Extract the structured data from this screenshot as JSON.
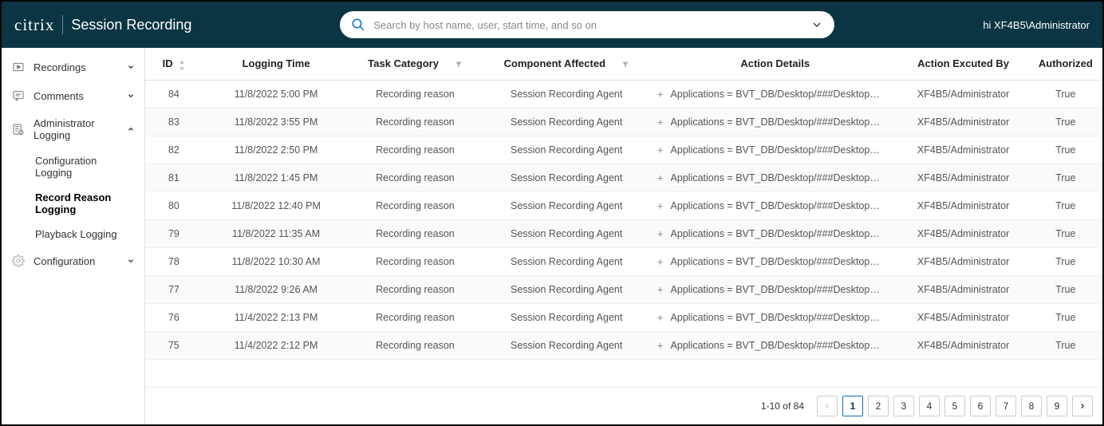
{
  "header": {
    "brand": "citrix",
    "subtitle": "Session Recording",
    "search_placeholder": "Search by host name, user, start time, and so on",
    "user_text": "hi XF4B5\\Administrator"
  },
  "sidebar": {
    "items": [
      {
        "label": "Recordings",
        "icon": "play-rect-icon",
        "expandable": true,
        "expanded": false
      },
      {
        "label": "Comments",
        "icon": "comment-icon",
        "expandable": true,
        "expanded": false
      },
      {
        "label": "Administrator Logging",
        "icon": "admin-log-icon",
        "expandable": true,
        "expanded": true,
        "children": [
          {
            "label": "Configuration Logging",
            "active": false
          },
          {
            "label": "Record Reason Logging",
            "active": true
          },
          {
            "label": "Playback Logging",
            "active": false
          }
        ]
      },
      {
        "label": "Configuration",
        "icon": "gear-icon",
        "expandable": true,
        "expanded": false
      }
    ]
  },
  "table": {
    "columns": [
      {
        "label": "ID",
        "sort": true
      },
      {
        "label": "Logging Time"
      },
      {
        "label": "Task Category",
        "filter": true
      },
      {
        "label": "Component Affected",
        "filter": true
      },
      {
        "label": "Action Details"
      },
      {
        "label": "Action Excuted By"
      },
      {
        "label": "Authorized"
      }
    ],
    "rows": [
      {
        "id": "84",
        "time": "11/8/2022 5:00 PM",
        "category": "Recording reason",
        "component": "Session Recording Agent",
        "details": "Applications = BVT_DB/Desktop/###Desktop…",
        "by": "XF4B5/Administrator",
        "authorized": "True"
      },
      {
        "id": "83",
        "time": "11/8/2022 3:55 PM",
        "category": "Recording reason",
        "component": "Session Recording Agent",
        "details": "Applications = BVT_DB/Desktop/###Desktop…",
        "by": "XF4B5/Administrator",
        "authorized": "True"
      },
      {
        "id": "82",
        "time": "11/8/2022 2:50 PM",
        "category": "Recording reason",
        "component": "Session Recording Agent",
        "details": "Applications = BVT_DB/Desktop/###Desktop…",
        "by": "XF4B5/Administrator",
        "authorized": "True"
      },
      {
        "id": "81",
        "time": "11/8/2022 1:45 PM",
        "category": "Recording reason",
        "component": "Session Recording Agent",
        "details": "Applications = BVT_DB/Desktop/###Desktop…",
        "by": "XF4B5/Administrator",
        "authorized": "True"
      },
      {
        "id": "80",
        "time": "11/8/2022 12:40 PM",
        "category": "Recording reason",
        "component": "Session Recording Agent",
        "details": "Applications = BVT_DB/Desktop/###Desktop…",
        "by": "XF4B5/Administrator",
        "authorized": "True"
      },
      {
        "id": "79",
        "time": "11/8/2022 11:35 AM",
        "category": "Recording reason",
        "component": "Session Recording Agent",
        "details": "Applications = BVT_DB/Desktop/###Desktop…",
        "by": "XF4B5/Administrator",
        "authorized": "True"
      },
      {
        "id": "78",
        "time": "11/8/2022 10:30 AM",
        "category": "Recording reason",
        "component": "Session Recording Agent",
        "details": "Applications = BVT_DB/Desktop/###Desktop…",
        "by": "XF4B5/Administrator",
        "authorized": "True"
      },
      {
        "id": "77",
        "time": "11/8/2022 9:26 AM",
        "category": "Recording reason",
        "component": "Session Recording Agent",
        "details": "Applications = BVT_DB/Desktop/###Desktop…",
        "by": "XF4B5/Administrator",
        "authorized": "True"
      },
      {
        "id": "76",
        "time": "11/4/2022 2:13 PM",
        "category": "Recording reason",
        "component": "Session Recording Agent",
        "details": "Applications = BVT_DB/Desktop/###Desktop…",
        "by": "XF4B5/Administrator",
        "authorized": "True"
      },
      {
        "id": "75",
        "time": "11/4/2022 2:12 PM",
        "category": "Recording reason",
        "component": "Session Recording Agent",
        "details": "Applications = BVT_DB/Desktop/###Desktop…",
        "by": "XF4B5/Administrator",
        "authorized": "True"
      }
    ]
  },
  "pagination": {
    "info": "1-10 of 84",
    "pages": [
      "1",
      "2",
      "3",
      "4",
      "5",
      "6",
      "7",
      "8",
      "9"
    ],
    "active_index": 0,
    "prev_disabled": true,
    "next_disabled": false
  }
}
